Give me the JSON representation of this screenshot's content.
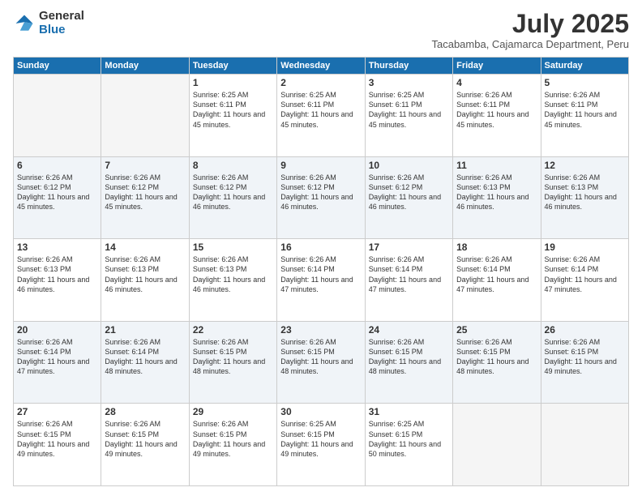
{
  "logo": {
    "general": "General",
    "blue": "Blue"
  },
  "title": "July 2025",
  "subtitle": "Tacabamba, Cajamarca Department, Peru",
  "days_of_week": [
    "Sunday",
    "Monday",
    "Tuesday",
    "Wednesday",
    "Thursday",
    "Friday",
    "Saturday"
  ],
  "weeks": [
    [
      {
        "day": "",
        "info": ""
      },
      {
        "day": "",
        "info": ""
      },
      {
        "day": "1",
        "info": "Sunrise: 6:25 AM\nSunset: 6:11 PM\nDaylight: 11 hours and 45 minutes."
      },
      {
        "day": "2",
        "info": "Sunrise: 6:25 AM\nSunset: 6:11 PM\nDaylight: 11 hours and 45 minutes."
      },
      {
        "day": "3",
        "info": "Sunrise: 6:25 AM\nSunset: 6:11 PM\nDaylight: 11 hours and 45 minutes."
      },
      {
        "day": "4",
        "info": "Sunrise: 6:26 AM\nSunset: 6:11 PM\nDaylight: 11 hours and 45 minutes."
      },
      {
        "day": "5",
        "info": "Sunrise: 6:26 AM\nSunset: 6:11 PM\nDaylight: 11 hours and 45 minutes."
      }
    ],
    [
      {
        "day": "6",
        "info": "Sunrise: 6:26 AM\nSunset: 6:12 PM\nDaylight: 11 hours and 45 minutes."
      },
      {
        "day": "7",
        "info": "Sunrise: 6:26 AM\nSunset: 6:12 PM\nDaylight: 11 hours and 45 minutes."
      },
      {
        "day": "8",
        "info": "Sunrise: 6:26 AM\nSunset: 6:12 PM\nDaylight: 11 hours and 46 minutes."
      },
      {
        "day": "9",
        "info": "Sunrise: 6:26 AM\nSunset: 6:12 PM\nDaylight: 11 hours and 46 minutes."
      },
      {
        "day": "10",
        "info": "Sunrise: 6:26 AM\nSunset: 6:12 PM\nDaylight: 11 hours and 46 minutes."
      },
      {
        "day": "11",
        "info": "Sunrise: 6:26 AM\nSunset: 6:13 PM\nDaylight: 11 hours and 46 minutes."
      },
      {
        "day": "12",
        "info": "Sunrise: 6:26 AM\nSunset: 6:13 PM\nDaylight: 11 hours and 46 minutes."
      }
    ],
    [
      {
        "day": "13",
        "info": "Sunrise: 6:26 AM\nSunset: 6:13 PM\nDaylight: 11 hours and 46 minutes."
      },
      {
        "day": "14",
        "info": "Sunrise: 6:26 AM\nSunset: 6:13 PM\nDaylight: 11 hours and 46 minutes."
      },
      {
        "day": "15",
        "info": "Sunrise: 6:26 AM\nSunset: 6:13 PM\nDaylight: 11 hours and 46 minutes."
      },
      {
        "day": "16",
        "info": "Sunrise: 6:26 AM\nSunset: 6:14 PM\nDaylight: 11 hours and 47 minutes."
      },
      {
        "day": "17",
        "info": "Sunrise: 6:26 AM\nSunset: 6:14 PM\nDaylight: 11 hours and 47 minutes."
      },
      {
        "day": "18",
        "info": "Sunrise: 6:26 AM\nSunset: 6:14 PM\nDaylight: 11 hours and 47 minutes."
      },
      {
        "day": "19",
        "info": "Sunrise: 6:26 AM\nSunset: 6:14 PM\nDaylight: 11 hours and 47 minutes."
      }
    ],
    [
      {
        "day": "20",
        "info": "Sunrise: 6:26 AM\nSunset: 6:14 PM\nDaylight: 11 hours and 47 minutes."
      },
      {
        "day": "21",
        "info": "Sunrise: 6:26 AM\nSunset: 6:14 PM\nDaylight: 11 hours and 48 minutes."
      },
      {
        "day": "22",
        "info": "Sunrise: 6:26 AM\nSunset: 6:15 PM\nDaylight: 11 hours and 48 minutes."
      },
      {
        "day": "23",
        "info": "Sunrise: 6:26 AM\nSunset: 6:15 PM\nDaylight: 11 hours and 48 minutes."
      },
      {
        "day": "24",
        "info": "Sunrise: 6:26 AM\nSunset: 6:15 PM\nDaylight: 11 hours and 48 minutes."
      },
      {
        "day": "25",
        "info": "Sunrise: 6:26 AM\nSunset: 6:15 PM\nDaylight: 11 hours and 48 minutes."
      },
      {
        "day": "26",
        "info": "Sunrise: 6:26 AM\nSunset: 6:15 PM\nDaylight: 11 hours and 49 minutes."
      }
    ],
    [
      {
        "day": "27",
        "info": "Sunrise: 6:26 AM\nSunset: 6:15 PM\nDaylight: 11 hours and 49 minutes."
      },
      {
        "day": "28",
        "info": "Sunrise: 6:26 AM\nSunset: 6:15 PM\nDaylight: 11 hours and 49 minutes."
      },
      {
        "day": "29",
        "info": "Sunrise: 6:26 AM\nSunset: 6:15 PM\nDaylight: 11 hours and 49 minutes."
      },
      {
        "day": "30",
        "info": "Sunrise: 6:25 AM\nSunset: 6:15 PM\nDaylight: 11 hours and 49 minutes."
      },
      {
        "day": "31",
        "info": "Sunrise: 6:25 AM\nSunset: 6:15 PM\nDaylight: 11 hours and 50 minutes."
      },
      {
        "day": "",
        "info": ""
      },
      {
        "day": "",
        "info": ""
      }
    ]
  ]
}
